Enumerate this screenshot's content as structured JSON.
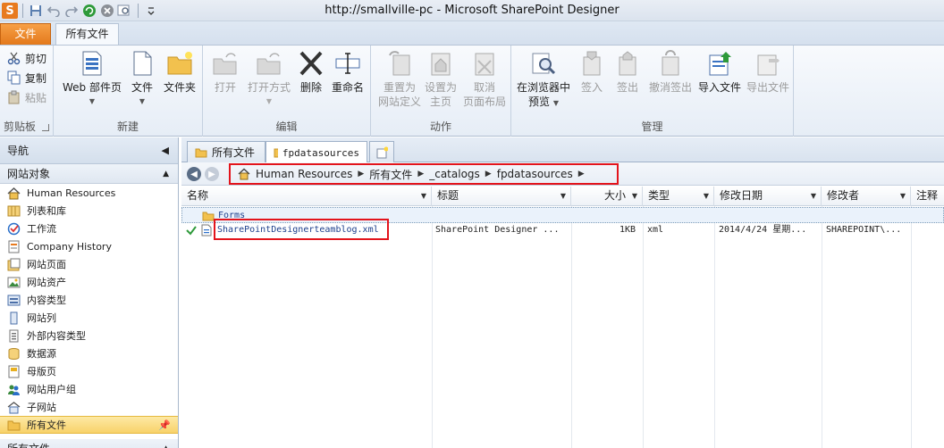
{
  "window": {
    "title": "http://smallville-pc  -  Microsoft SharePoint Designer",
    "logo_letter": "S"
  },
  "ribbon_tabs": {
    "file": "文件",
    "all_files": "所有文件"
  },
  "clipboard": {
    "cut": "剪切",
    "copy": "复制",
    "paste": "粘贴",
    "label": "剪贴板"
  },
  "new_group": {
    "web_part": "Web 部件页",
    "file": "文件",
    "folder": "文件夹",
    "label": "新建"
  },
  "edit_group": {
    "open": "打开",
    "open_with": "打开方式",
    "delete": "删除",
    "rename": "重命名",
    "label": "编辑"
  },
  "actions_group": {
    "reset_def_1": "重置为",
    "reset_def_2": "网站定义",
    "set_home_1": "设置为",
    "set_home_2": "主页",
    "detach_1": "取消",
    "detach_2": "页面布局",
    "label": "动作"
  },
  "manage_group": {
    "preview_1": "在浏览器中",
    "preview_2": "预览",
    "checkin": "签入",
    "checkout": "签出",
    "undo_checkout": "撤消签出",
    "import": "导入文件",
    "export": "导出文件",
    "label": "管理"
  },
  "nav": {
    "title": "导航",
    "section": "网站对象",
    "items": [
      "Human Resources",
      "列表和库",
      "工作流",
      "Company History",
      "网站页面",
      "网站资产",
      "内容类型",
      "网站列",
      "外部内容类型",
      "数据源",
      "母版页",
      "网站用户组",
      "子网站",
      "所有文件"
    ],
    "bottom_section": "所有文件"
  },
  "doc_tabs": [
    "所有文件",
    "fpdatasources"
  ],
  "breadcrumb": [
    "Human Resources",
    "所有文件",
    "_catalogs",
    "fpdatasources"
  ],
  "columns": [
    "名称",
    "标题",
    "大小",
    "类型",
    "修改日期",
    "修改者",
    "注释"
  ],
  "rows": [
    {
      "name": "Forms",
      "title": "",
      "size": "",
      "type": "",
      "modified": "",
      "modified_by": ""
    },
    {
      "name": "SharePointDesignerteamblog.xml",
      "title": "SharePoint Designer ...",
      "size": "1KB",
      "type": "xml",
      "modified": "2014/4/24 星期...",
      "modified_by": "SHAREPOINT\\..."
    }
  ],
  "colors": {
    "file_tab": "#e3791c",
    "highlight": "#e3141c",
    "active_nav": "#f8d26a"
  }
}
